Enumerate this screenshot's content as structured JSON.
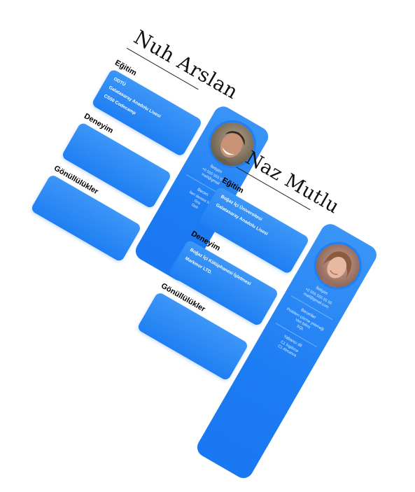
{
  "card1": {
    "name": "Nuh Arslan",
    "education_heading": "Eğitim",
    "education": [
      "ODTÜ",
      "Galatasaray Anadolu Lisesi",
      "CS50 Codecamp"
    ],
    "experience_heading": "Deneyim",
    "volunteer_heading": "Gönüllülükler",
    "contact_heading": "İletişim",
    "phone": "+0 550 555 57",
    "email": "mail@gmail",
    "skills_heading": "Beceri",
    "skills": [
      "İleri derece M",
      "Gra",
      "Gelı"
    ]
  },
  "card2": {
    "name": "Naz Mutlu",
    "education_heading": "Eğitim",
    "education": [
      "Boğaz İçi Üniversitesi",
      "Galatasaray Anadolu Lisesi"
    ],
    "experience_heading": "Deneyim",
    "experience": [
      "Boğaz İçi Kütüphanesi İşletmesi",
      "Markmor LTD."
    ],
    "volunteer_heading": "Gönüllülükler",
    "contact_heading": "İletişim",
    "phone": "+0 555 555 55 55",
    "email": "mail@gmail.com",
    "skills_heading": "Beceriler",
    "skills": [
      "Problem çözme yeteneği",
      "Veri bilimi",
      "SQL"
    ],
    "languages_heading": "Yabancı dil",
    "languages": [
      "C1 İngilizce",
      "C1 Almanca"
    ]
  }
}
